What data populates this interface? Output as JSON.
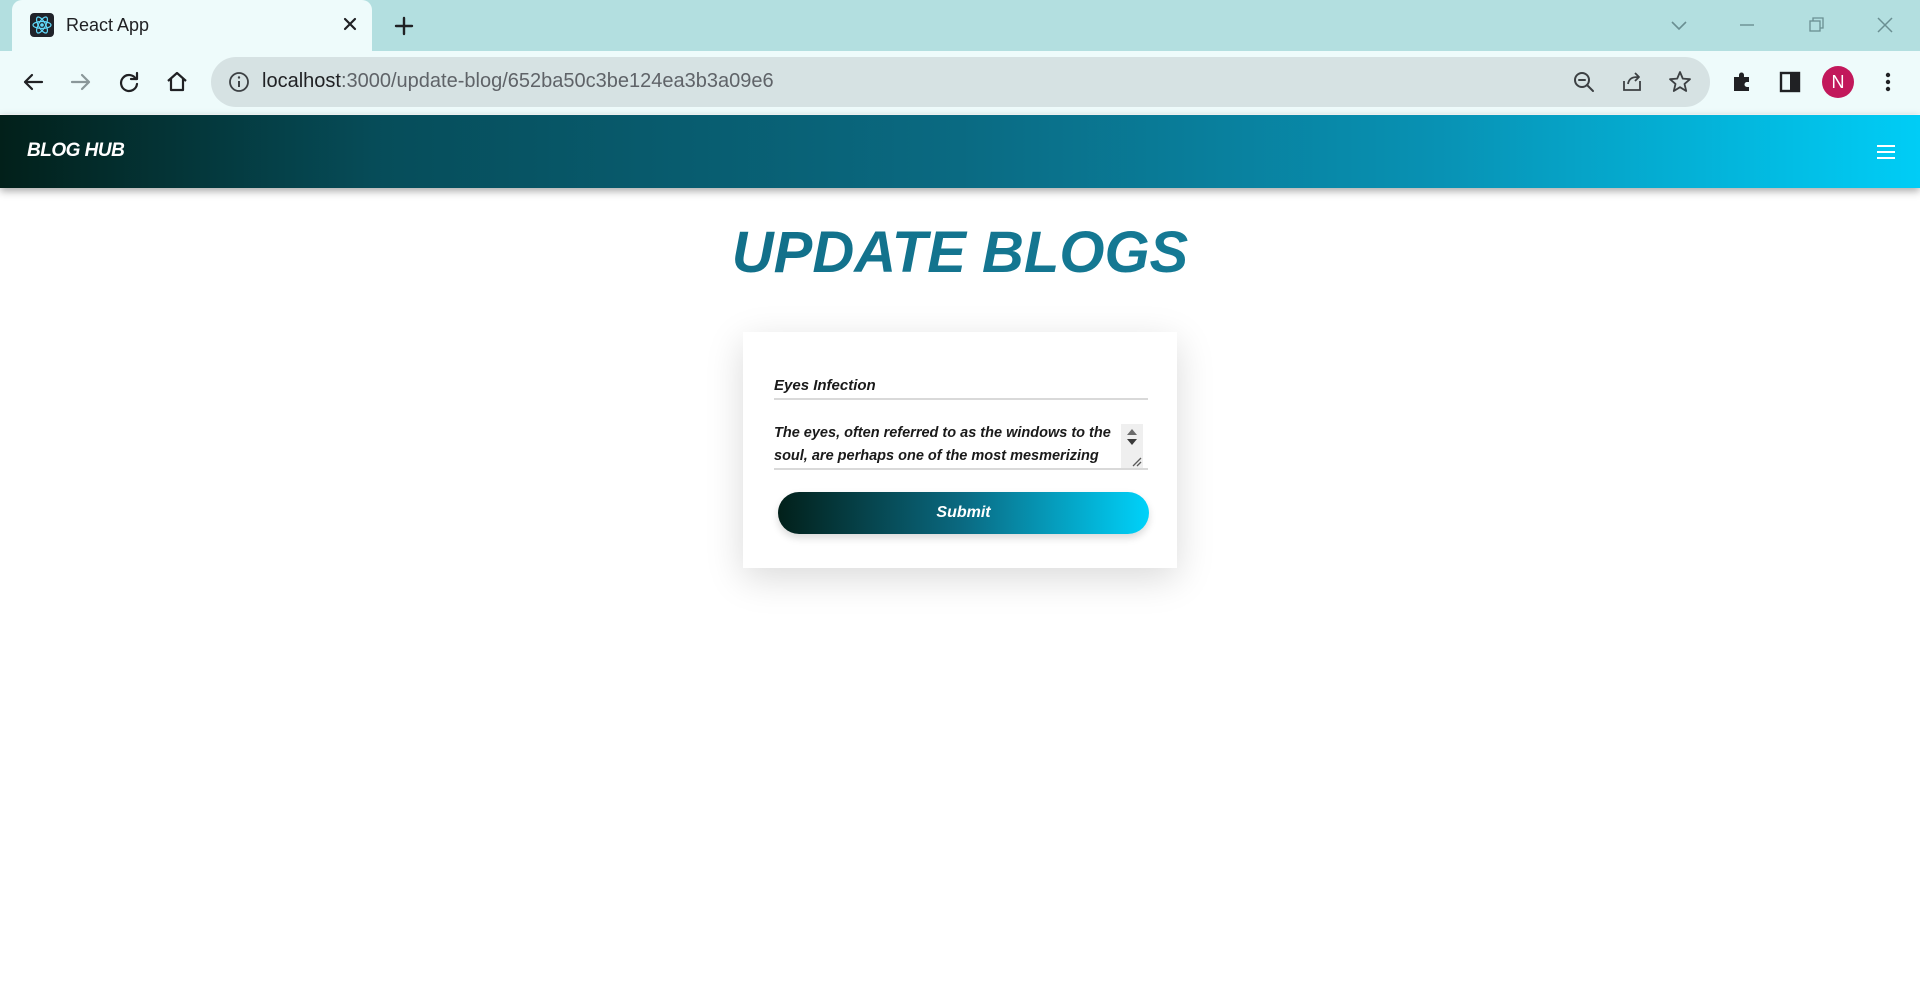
{
  "browser": {
    "tab_title": "React App",
    "url_host": "localhost",
    "url_path": ":3000/update-blog/652ba50c3be124ea3b3a09e6",
    "profile_initial": "N"
  },
  "app": {
    "brand": "BLOG HUB",
    "page_title": "UPDATE BLOGS",
    "form": {
      "title_value": "Eyes Infection",
      "description_value": "The eyes, often referred to as the windows to the soul, are perhaps one of the most mesmerizing",
      "submit_label": "Submit"
    }
  },
  "colors": {
    "navbar_start": "#02201a",
    "navbar_end": "#00cdf6",
    "title": "#0d5f78",
    "avatar": "#c2185b"
  }
}
